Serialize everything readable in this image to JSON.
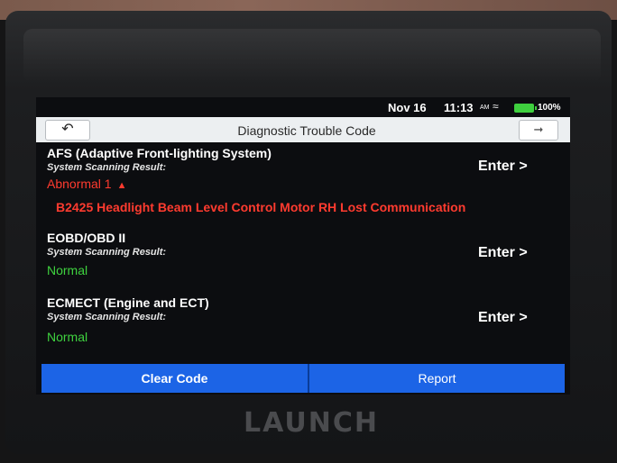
{
  "status_bar": {
    "date": "Nov 16",
    "time": "11:13",
    "ampm": "AM",
    "battery": "100%"
  },
  "header": {
    "title": "Diagnostic Trouble Code"
  },
  "systems": [
    {
      "name": "AFS (Adaptive Front-lighting System)",
      "subtitle": "System Scanning Result:",
      "status": "Abnormal 1",
      "enter_label": "Enter >",
      "dtc": "B2425 Headlight Beam Level Control Motor RH Lost Communication"
    },
    {
      "name": "EOBD/OBD II",
      "subtitle": "System Scanning Result:",
      "status": "Normal",
      "enter_label": "Enter >"
    },
    {
      "name": "ECMECT (Engine and ECT)",
      "subtitle": "System Scanning Result:",
      "status": "Normal",
      "enter_label": "Enter >"
    }
  ],
  "actions": {
    "clear_code": "Clear Code",
    "report": "Report"
  },
  "device": {
    "brand": "LAUNCH"
  },
  "colors": {
    "accent": "#1c64e6",
    "abnormal": "#ff3b2f",
    "normal": "#3fd23f"
  }
}
